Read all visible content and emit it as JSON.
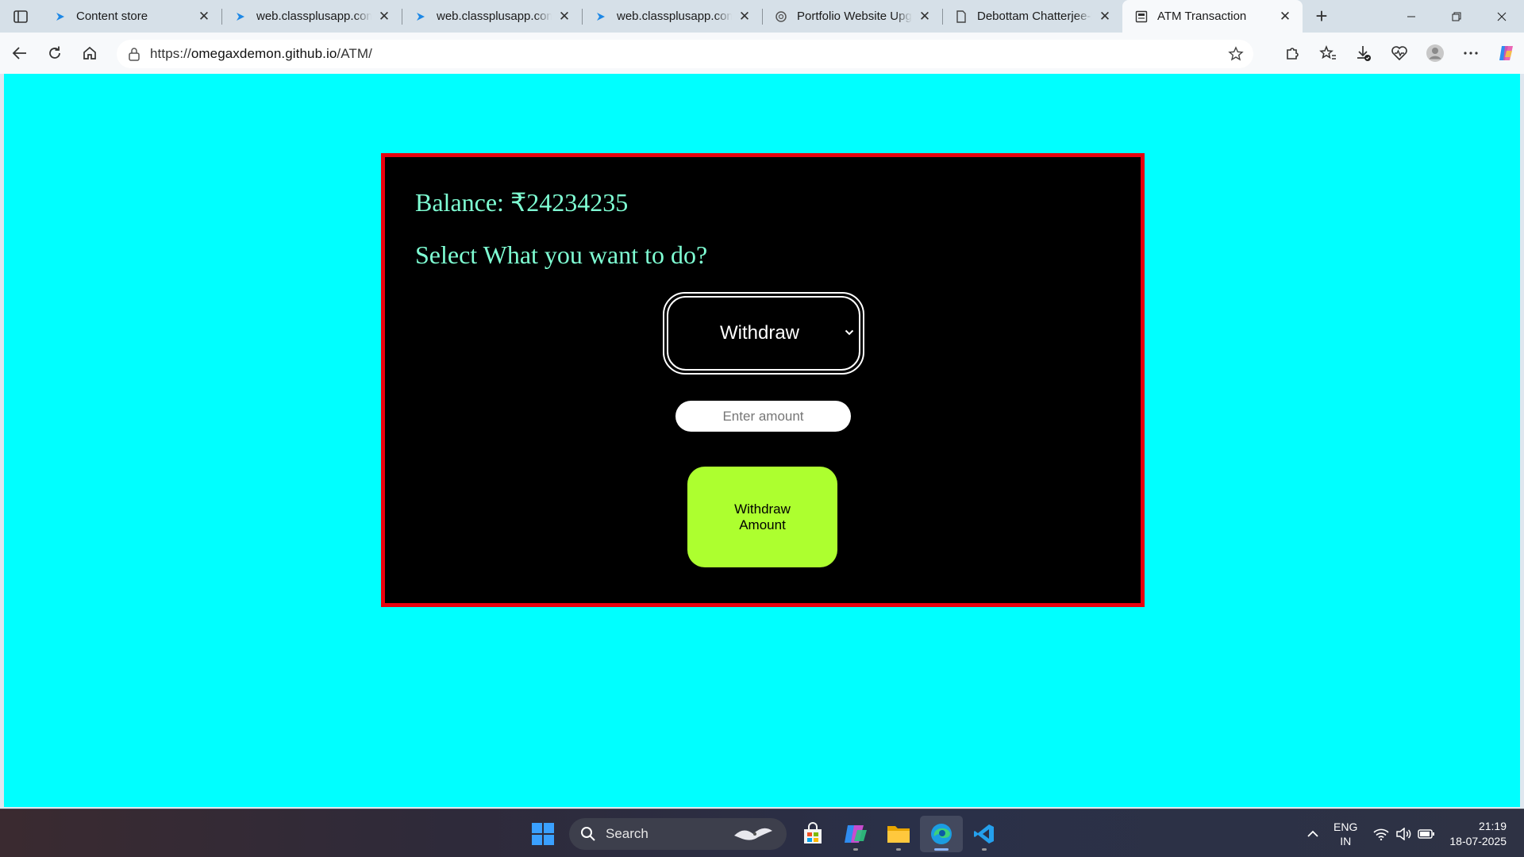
{
  "browser": {
    "tabs": [
      {
        "title": "Content store",
        "icon": "classplus-icon"
      },
      {
        "title": "web.classplusapp.com/",
        "icon": "classplus-icon"
      },
      {
        "title": "web.classplusapp.com/",
        "icon": "classplus-icon"
      },
      {
        "title": "web.classplusapp.com/",
        "icon": "classplus-icon"
      },
      {
        "title": "Portfolio Website Upgr",
        "icon": "chatgpt-icon"
      },
      {
        "title": "Debottam Chatterjee-F",
        "icon": "document-icon"
      },
      {
        "title": "ATM Transaction",
        "icon": "page-icon",
        "active": true
      }
    ],
    "url_prefix": "https://",
    "url_host": "omegaxdemon.github.io",
    "url_path": "/ATM/"
  },
  "atm": {
    "balance": "Balance: ₹24234235",
    "prompt": "Select What you want to do?",
    "action_selected": "Withdraw",
    "amount_placeholder": "Enter amount",
    "amount_value": "",
    "submit_label": "Withdraw Amount"
  },
  "taskbar": {
    "search_label": "Search",
    "lang_top": "ENG",
    "lang_bottom": "IN",
    "time": "21:19",
    "date": "18-07-2025"
  },
  "colors": {
    "page_bg": "#00ffff",
    "panel_bg": "#000000",
    "panel_border": "#e8000d",
    "text_accent": "#7fffd4",
    "button_bg": "#adff2f"
  }
}
